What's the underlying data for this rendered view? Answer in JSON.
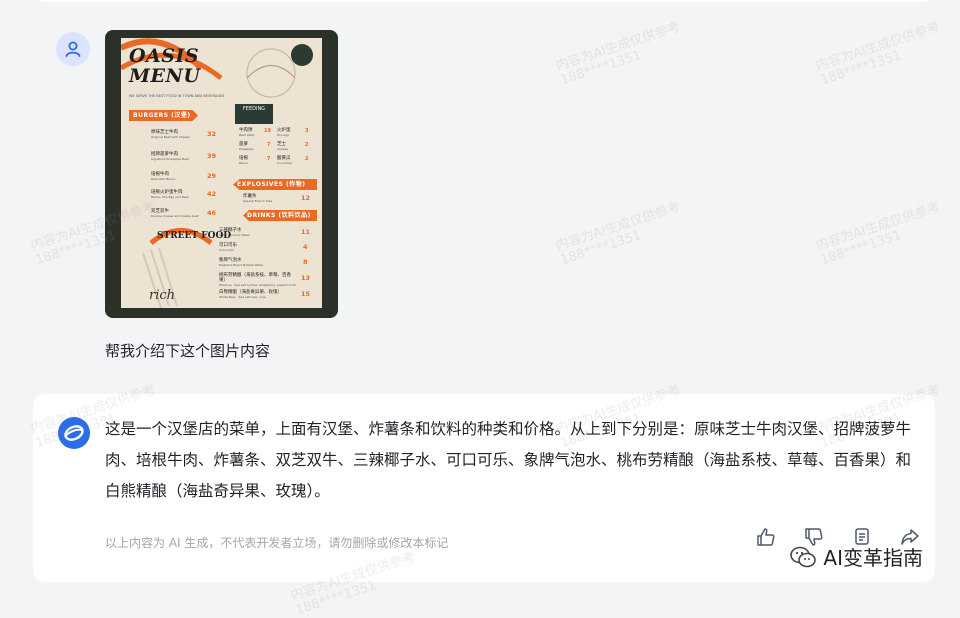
{
  "user_message": {
    "prompt": "帮我介绍下这个图片内容"
  },
  "menu_image": {
    "title": "OASIS MENU",
    "subtitle": "WE SERVE THE BEST FOOD IN TOWN AND BEVERAGES",
    "sections": {
      "burgers": "BURGERS (汉堡)",
      "feeding": "FEEDING",
      "explosives": "EXPLOSIVES (炸物)",
      "drinks": "DRINKS (饮料饮品)"
    },
    "burgers": [
      {
        "zh": "原味芝士牛肉",
        "en": "Original Beef with Cheese",
        "price": "32"
      },
      {
        "zh": "招牌菠萝牛肉",
        "en": "Signature Pineapple Beef",
        "price": "39"
      },
      {
        "zh": "培根牛肉",
        "en": "Beef with Bacon",
        "price": "29"
      },
      {
        "zh": "培根火炉蛋牛肉",
        "en": "Bacon, Fire Egg and Beef",
        "price": "42"
      },
      {
        "zh": "双芝双牛",
        "en": "Double cheese and double beef",
        "price": "46"
      }
    ],
    "feeding": [
      {
        "zh": "牛肉饼",
        "en": "Beef patty",
        "price": "19"
      },
      {
        "zh": "菠萝",
        "en": "Pineapple",
        "price": "7"
      },
      {
        "zh": "培根",
        "en": "Bacon",
        "price": "7"
      },
      {
        "zh": "火炉蛋",
        "en": "Fire egg",
        "price": "3"
      },
      {
        "zh": "芝士",
        "en": "Cheese",
        "price": "2"
      },
      {
        "zh": "酸黄瓜",
        "en": "Cucumber",
        "price": "2"
      }
    ],
    "explosives": [
      {
        "zh": "炸薯条",
        "en": "Special French fries",
        "price": "12"
      }
    ],
    "drinks": [
      {
        "zh": "三辣椰子水",
        "en": "Spicy Coconut Water",
        "price": "11"
      },
      {
        "zh": "可口可乐",
        "en": "Coca Cola",
        "price": "4"
      },
      {
        "zh": "象牌气泡水",
        "en": "Elephant Brand Bubble Water",
        "price": "8"
      },
      {
        "zh": "桃布劳精酿（海盐系枝、草莓、百香果）",
        "en": "Hibiscus · Sea salt lychee, strawberry, passion fruit",
        "price": "13"
      },
      {
        "zh": "白熊精酿（海盐奇异果、玫瑰）",
        "en": "White Bear · Sea salt kiwi, rose",
        "price": "15"
      }
    ],
    "street_food": "STREET FOOD",
    "rich": "rich"
  },
  "assistant_message": {
    "text": "这是一个汉堡店的菜单，上面有汉堡、炸薯条和饮料的种类和价格。从上到下分别是：原味芝士牛肉汉堡、招牌菠萝牛肉、培根牛肉、炸薯条、双芝双牛、三辣椰子水、可口可乐、象牌气泡水、桃布劳精酿（海盐系枝、草莓、百香果）和白熊精酿（海盐奇异果、玫瑰）。",
    "disclaimer": "以上内容为 AI 生成，不代表开发者立场，请勿删除或修改本标记"
  },
  "actions": {
    "icons": [
      "thumbs-up-icon",
      "thumbs-down-icon",
      "copy-icon",
      "share-icon"
    ]
  },
  "brand_watermark": {
    "text": "AI变革指南"
  },
  "overlay_watermark": {
    "line1": "内容为AI生成仅供参考",
    "line2": "188****1351"
  },
  "colors": {
    "accent": "#e86a25",
    "bot_blue": "#2b6de8",
    "avatar_bg": "#dbe4ff"
  }
}
